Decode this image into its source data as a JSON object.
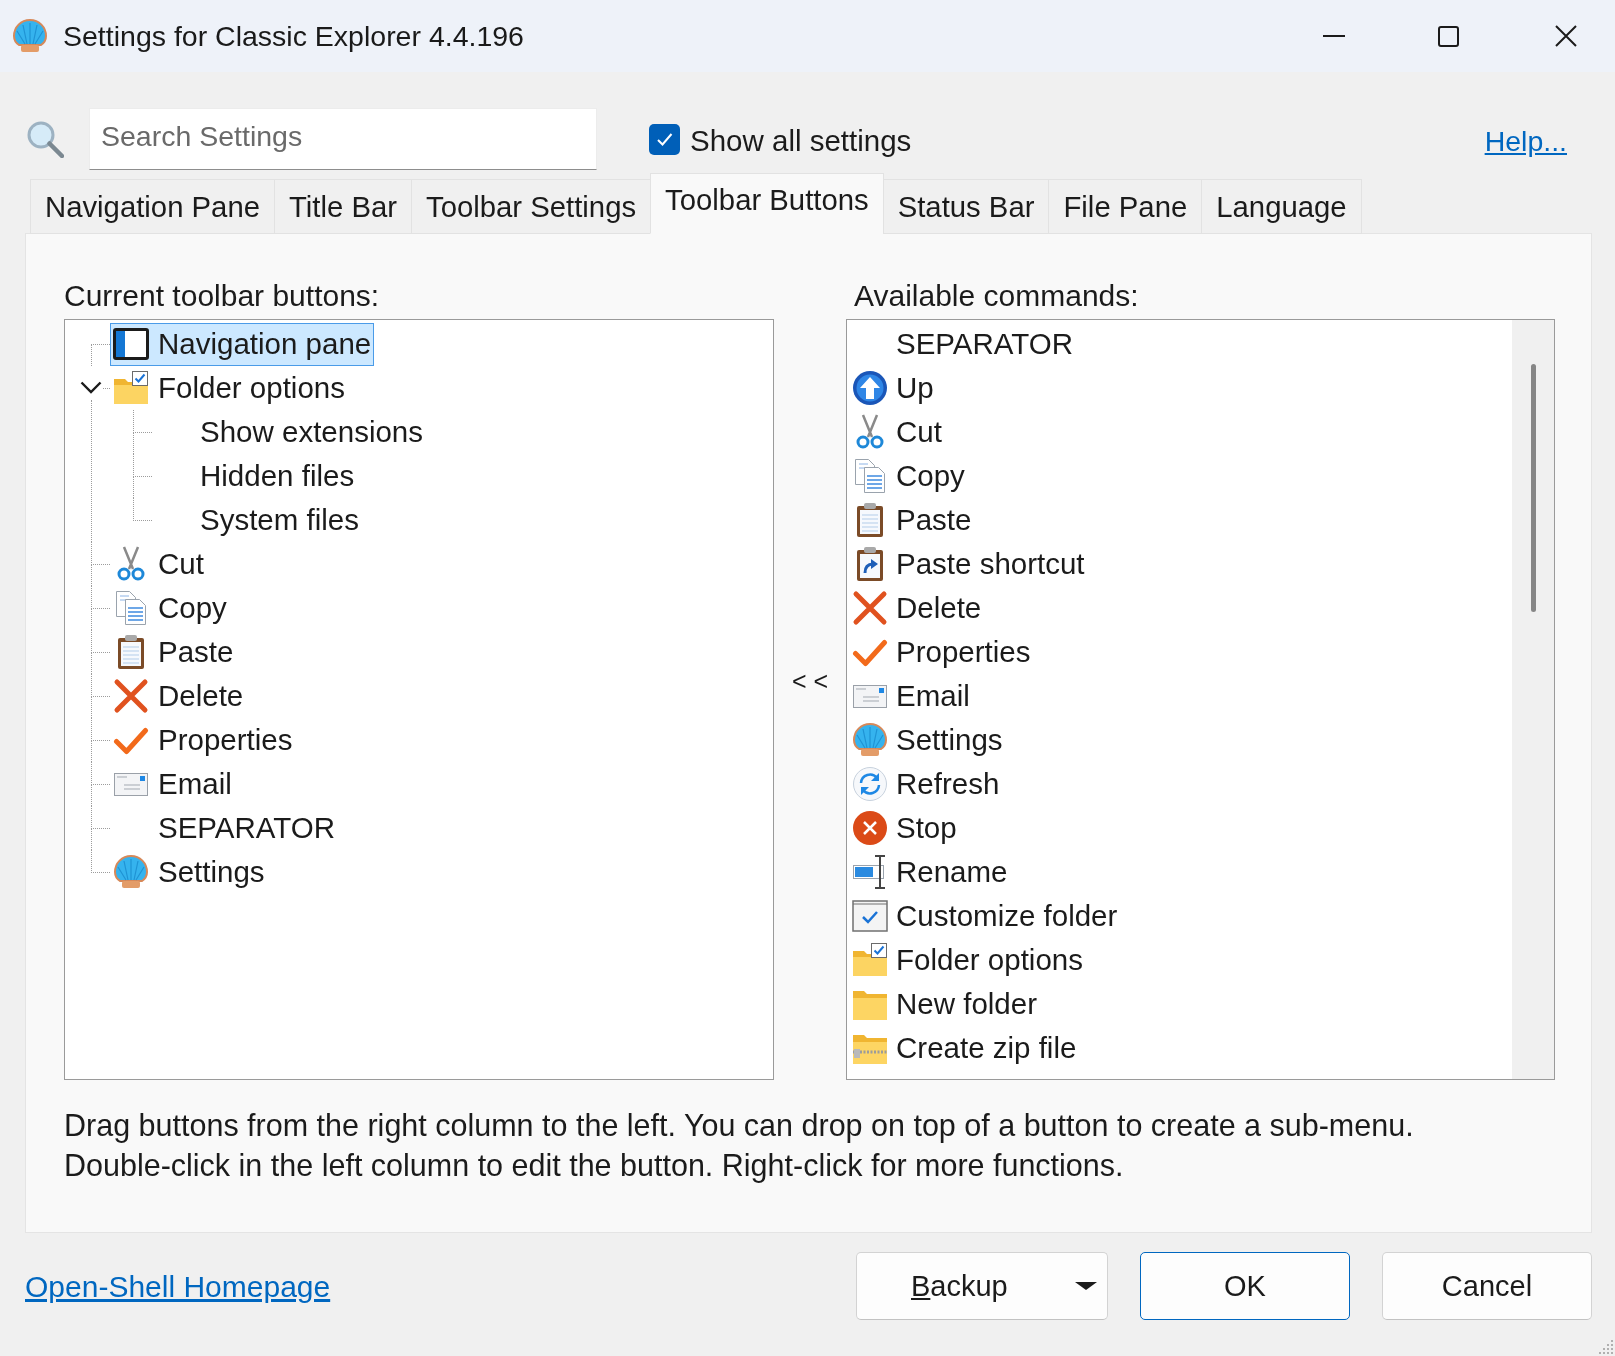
{
  "window": {
    "title": "Settings for Classic Explorer 4.4.196"
  },
  "search": {
    "placeholder": "Search Settings"
  },
  "show_all": {
    "label": "Show all settings",
    "checked": true
  },
  "help_link": "Help...",
  "tabs": [
    {
      "label": "Navigation Pane",
      "selected": false
    },
    {
      "label": "Title Bar",
      "selected": false
    },
    {
      "label": "Toolbar Settings",
      "selected": false
    },
    {
      "label": "Toolbar Buttons",
      "selected": true
    },
    {
      "label": "Status Bar",
      "selected": false
    },
    {
      "label": "File Pane",
      "selected": false
    },
    {
      "label": "Language",
      "selected": false
    }
  ],
  "current_buttons": {
    "heading": "Current toolbar buttons:",
    "items": [
      {
        "label": "Navigation pane",
        "kind": "navpane",
        "selected": true
      },
      {
        "label": "Folder options",
        "kind": "folderoptions",
        "selected": false,
        "expanded": true,
        "children": [
          {
            "label": "Show extensions",
            "selected": false
          },
          {
            "label": "Hidden files",
            "selected": false
          },
          {
            "label": "System files",
            "selected": false
          }
        ]
      },
      {
        "label": "Cut",
        "kind": "cut",
        "selected": false
      },
      {
        "label": "Copy",
        "kind": "copy",
        "selected": false
      },
      {
        "label": "Paste",
        "kind": "paste",
        "selected": false
      },
      {
        "label": "Delete",
        "kind": "delete",
        "selected": false
      },
      {
        "label": "Properties",
        "kind": "properties",
        "selected": false
      },
      {
        "label": "Email",
        "kind": "email",
        "selected": false
      },
      {
        "label": "SEPARATOR",
        "kind": "separator",
        "selected": false
      },
      {
        "label": "Settings",
        "kind": "settings",
        "selected": false
      }
    ]
  },
  "move_button": "< <",
  "available_commands": {
    "heading": "Available commands:",
    "items": [
      {
        "label": "SEPARATOR",
        "kind": "separator",
        "selected": false
      },
      {
        "label": "Up",
        "kind": "up",
        "selected": false
      },
      {
        "label": "Cut",
        "kind": "cut",
        "selected": false
      },
      {
        "label": "Copy",
        "kind": "copy",
        "selected": false
      },
      {
        "label": "Paste",
        "kind": "paste",
        "selected": false
      },
      {
        "label": "Paste shortcut",
        "kind": "shortcut",
        "selected": false
      },
      {
        "label": "Delete",
        "kind": "delete",
        "selected": false
      },
      {
        "label": "Properties",
        "kind": "properties",
        "selected": false
      },
      {
        "label": "Email",
        "kind": "email",
        "selected": false
      },
      {
        "label": "Settings",
        "kind": "settings",
        "selected": false
      },
      {
        "label": "Refresh",
        "kind": "refresh",
        "selected": false
      },
      {
        "label": "Stop",
        "kind": "stop",
        "selected": false
      },
      {
        "label": "Rename",
        "kind": "rename",
        "selected": false
      },
      {
        "label": "Customize folder",
        "kind": "customize",
        "selected": false
      },
      {
        "label": "Folder options",
        "kind": "folderoptions",
        "selected": false
      },
      {
        "label": "New folder",
        "kind": "newfolder",
        "selected": false
      },
      {
        "label": "Create zip file",
        "kind": "zip",
        "selected": false
      }
    ]
  },
  "description": [
    "Drag buttons from the right column to the left. You can drop on top of a button to create a sub-menu.",
    "Double-click in the left column to edit the button. Right-click for more functions."
  ],
  "homepage_link": "Open-Shell Homepage",
  "buttons": [
    {
      "label": "Backup",
      "kind": "dropdown",
      "access_key": true
    },
    {
      "label": "OK",
      "kind": "default",
      "access_key": false
    },
    {
      "label": "Cancel",
      "kind": "normal",
      "access_key": false
    }
  ]
}
